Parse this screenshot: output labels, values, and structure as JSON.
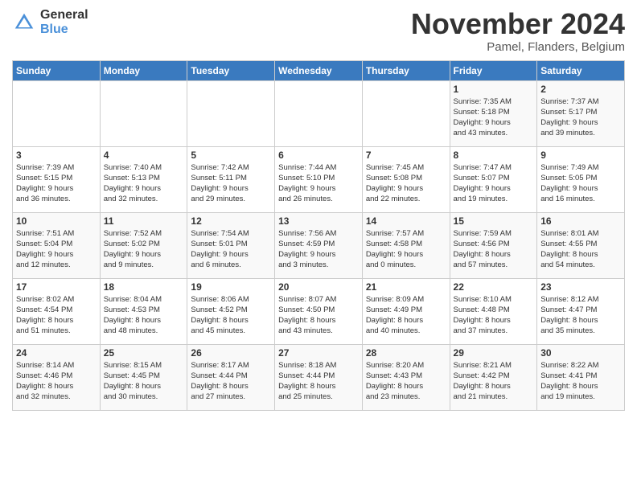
{
  "logo": {
    "general": "General",
    "blue": "Blue"
  },
  "title": "November 2024",
  "subtitle": "Pamel, Flanders, Belgium",
  "headers": [
    "Sunday",
    "Monday",
    "Tuesday",
    "Wednesday",
    "Thursday",
    "Friday",
    "Saturday"
  ],
  "weeks": [
    [
      {
        "day": "",
        "info": ""
      },
      {
        "day": "",
        "info": ""
      },
      {
        "day": "",
        "info": ""
      },
      {
        "day": "",
        "info": ""
      },
      {
        "day": "",
        "info": ""
      },
      {
        "day": "1",
        "info": "Sunrise: 7:35 AM\nSunset: 5:18 PM\nDaylight: 9 hours\nand 43 minutes."
      },
      {
        "day": "2",
        "info": "Sunrise: 7:37 AM\nSunset: 5:17 PM\nDaylight: 9 hours\nand 39 minutes."
      }
    ],
    [
      {
        "day": "3",
        "info": "Sunrise: 7:39 AM\nSunset: 5:15 PM\nDaylight: 9 hours\nand 36 minutes."
      },
      {
        "day": "4",
        "info": "Sunrise: 7:40 AM\nSunset: 5:13 PM\nDaylight: 9 hours\nand 32 minutes."
      },
      {
        "day": "5",
        "info": "Sunrise: 7:42 AM\nSunset: 5:11 PM\nDaylight: 9 hours\nand 29 minutes."
      },
      {
        "day": "6",
        "info": "Sunrise: 7:44 AM\nSunset: 5:10 PM\nDaylight: 9 hours\nand 26 minutes."
      },
      {
        "day": "7",
        "info": "Sunrise: 7:45 AM\nSunset: 5:08 PM\nDaylight: 9 hours\nand 22 minutes."
      },
      {
        "day": "8",
        "info": "Sunrise: 7:47 AM\nSunset: 5:07 PM\nDaylight: 9 hours\nand 19 minutes."
      },
      {
        "day": "9",
        "info": "Sunrise: 7:49 AM\nSunset: 5:05 PM\nDaylight: 9 hours\nand 16 minutes."
      }
    ],
    [
      {
        "day": "10",
        "info": "Sunrise: 7:51 AM\nSunset: 5:04 PM\nDaylight: 9 hours\nand 12 minutes."
      },
      {
        "day": "11",
        "info": "Sunrise: 7:52 AM\nSunset: 5:02 PM\nDaylight: 9 hours\nand 9 minutes."
      },
      {
        "day": "12",
        "info": "Sunrise: 7:54 AM\nSunset: 5:01 PM\nDaylight: 9 hours\nand 6 minutes."
      },
      {
        "day": "13",
        "info": "Sunrise: 7:56 AM\nSunset: 4:59 PM\nDaylight: 9 hours\nand 3 minutes."
      },
      {
        "day": "14",
        "info": "Sunrise: 7:57 AM\nSunset: 4:58 PM\nDaylight: 9 hours\nand 0 minutes."
      },
      {
        "day": "15",
        "info": "Sunrise: 7:59 AM\nSunset: 4:56 PM\nDaylight: 8 hours\nand 57 minutes."
      },
      {
        "day": "16",
        "info": "Sunrise: 8:01 AM\nSunset: 4:55 PM\nDaylight: 8 hours\nand 54 minutes."
      }
    ],
    [
      {
        "day": "17",
        "info": "Sunrise: 8:02 AM\nSunset: 4:54 PM\nDaylight: 8 hours\nand 51 minutes."
      },
      {
        "day": "18",
        "info": "Sunrise: 8:04 AM\nSunset: 4:53 PM\nDaylight: 8 hours\nand 48 minutes."
      },
      {
        "day": "19",
        "info": "Sunrise: 8:06 AM\nSunset: 4:52 PM\nDaylight: 8 hours\nand 45 minutes."
      },
      {
        "day": "20",
        "info": "Sunrise: 8:07 AM\nSunset: 4:50 PM\nDaylight: 8 hours\nand 43 minutes."
      },
      {
        "day": "21",
        "info": "Sunrise: 8:09 AM\nSunset: 4:49 PM\nDaylight: 8 hours\nand 40 minutes."
      },
      {
        "day": "22",
        "info": "Sunrise: 8:10 AM\nSunset: 4:48 PM\nDaylight: 8 hours\nand 37 minutes."
      },
      {
        "day": "23",
        "info": "Sunrise: 8:12 AM\nSunset: 4:47 PM\nDaylight: 8 hours\nand 35 minutes."
      }
    ],
    [
      {
        "day": "24",
        "info": "Sunrise: 8:14 AM\nSunset: 4:46 PM\nDaylight: 8 hours\nand 32 minutes."
      },
      {
        "day": "25",
        "info": "Sunrise: 8:15 AM\nSunset: 4:45 PM\nDaylight: 8 hours\nand 30 minutes."
      },
      {
        "day": "26",
        "info": "Sunrise: 8:17 AM\nSunset: 4:44 PM\nDaylight: 8 hours\nand 27 minutes."
      },
      {
        "day": "27",
        "info": "Sunrise: 8:18 AM\nSunset: 4:44 PM\nDaylight: 8 hours\nand 25 minutes."
      },
      {
        "day": "28",
        "info": "Sunrise: 8:20 AM\nSunset: 4:43 PM\nDaylight: 8 hours\nand 23 minutes."
      },
      {
        "day": "29",
        "info": "Sunrise: 8:21 AM\nSunset: 4:42 PM\nDaylight: 8 hours\nand 21 minutes."
      },
      {
        "day": "30",
        "info": "Sunrise: 8:22 AM\nSunset: 4:41 PM\nDaylight: 8 hours\nand 19 minutes."
      }
    ]
  ]
}
